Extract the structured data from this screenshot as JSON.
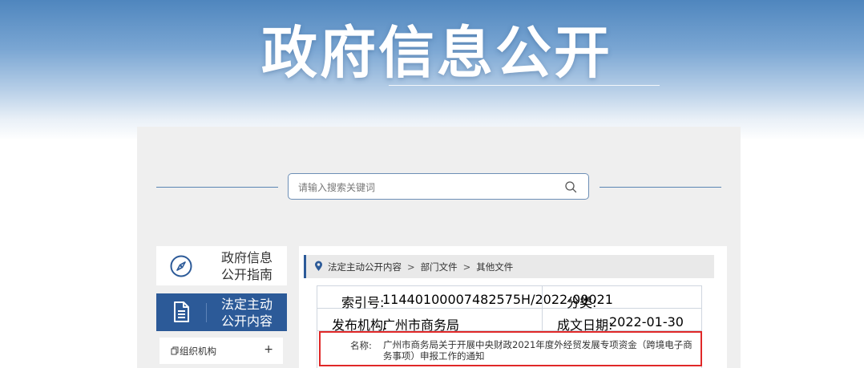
{
  "banner": {
    "title": "政府信息公开"
  },
  "search": {
    "placeholder": "请输入搜索关键词",
    "value": ""
  },
  "sidebar": {
    "items": [
      {
        "label_line1": "政府信息",
        "label_line2": "公开指南",
        "icon": "compass-icon",
        "active": false
      },
      {
        "label_line1": "法定主动",
        "label_line2": "公开内容",
        "icon": "document-icon",
        "active": true
      },
      {
        "label": "组织机构",
        "icon": "copy-icon",
        "toggle": "+"
      }
    ]
  },
  "breadcrumb": {
    "items": [
      "法定主动公开内容",
      "部门文件",
      "其他文件"
    ],
    "separator": ">"
  },
  "doc_info": {
    "index_label": "索引号:",
    "index_value": "11440100007482575H/2022-00021",
    "category_label": "分类:",
    "category_value": "",
    "publisher_label": "发布机构:",
    "publisher_value": "广州市商务局",
    "date_label": "成文日期:",
    "date_value": "2022-01-30",
    "name_label": "名称:",
    "name_value": "广州市商务局关于开展中央财政2021年度外经贸发展专项资金（跨境电子商务事项）申报工作的通知"
  },
  "colors": {
    "accent": "#2c5a98",
    "highlight": "#e02828",
    "banner": "#4f86be"
  }
}
